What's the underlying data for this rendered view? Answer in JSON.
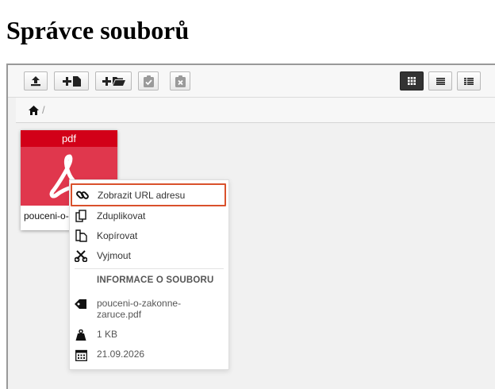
{
  "page": {
    "title": "Správce souborů"
  },
  "toolbar": {
    "buttons": [
      {
        "name": "upload",
        "icon": "upload-icon",
        "state": "normal"
      },
      {
        "name": "new-file",
        "icon": "plus-file-icon",
        "state": "normal"
      },
      {
        "name": "new-folder",
        "icon": "plus-folder-icon",
        "state": "normal"
      },
      {
        "name": "paste",
        "icon": "clipboard-check-icon",
        "state": "disabled"
      },
      {
        "name": "clear-clipboard",
        "icon": "clipboard-x-icon",
        "state": "disabled"
      }
    ],
    "views": [
      {
        "name": "view-grid",
        "icon": "grid-icon",
        "active": true
      },
      {
        "name": "view-list",
        "icon": "list-icon",
        "active": false
      },
      {
        "name": "view-details",
        "icon": "details-icon",
        "active": false
      }
    ]
  },
  "breadcrumb": {
    "home_icon": "home-icon",
    "separator": "/"
  },
  "file": {
    "type_label": "pdf",
    "short_name": "pouceni-o-",
    "color_header": "#d20018",
    "color_body": "#e0374d"
  },
  "context_menu": {
    "items": [
      {
        "name": "show-url",
        "label": "Zobrazit URL adresu",
        "icon": "link-icon",
        "highlighted": true
      },
      {
        "name": "duplicate",
        "label": "Zduplikovat",
        "icon": "duplicate-icon"
      },
      {
        "name": "copy",
        "label": "Kopírovat",
        "icon": "copy-icon"
      },
      {
        "name": "cut",
        "label": "Vyjmout",
        "icon": "scissors-icon"
      }
    ],
    "info_title": "INFORMACE O SOUBORU",
    "info": {
      "filename": "pouceni-o-zakonne-zaruce.pdf",
      "size": "1 KB",
      "date": "21.09.2026"
    }
  },
  "colors": {
    "highlight_border": "#d9512c",
    "active_view": "#333333"
  }
}
